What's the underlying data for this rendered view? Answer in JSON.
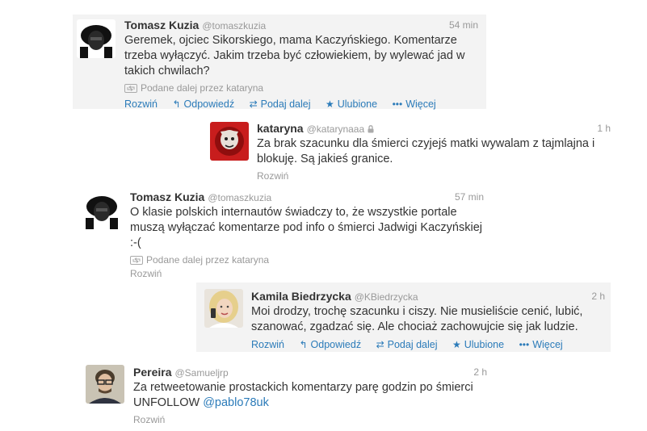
{
  "tweets": [
    {
      "name": "Tomasz Kuzia",
      "handle": "@tomaszkuzia",
      "time": "54 min",
      "text": "Geremek, ojciec Sikorskiego, mama Kaczyńskiego. Komentarze trzeba wyłączyć. Jakim trzeba być człowiekiem, by wylewać jad w takich chwilach?",
      "retweeted_by": "Podane dalej przez kataryna",
      "actions": {
        "expand": "Rozwiń",
        "reply": "Odpowiedź",
        "retweet": "Podaj dalej",
        "favorite": "Ulubione",
        "more": "Więcej"
      }
    },
    {
      "name": "kataryna",
      "handle": "@katarynaaa",
      "time": "1 h",
      "text": "Za brak szacunku dla śmierci czyjejś matki wywalam z tajmlajna i blokuję. Są jakieś granice.",
      "expand": "Rozwiń"
    },
    {
      "name": "Tomasz Kuzia",
      "handle": "@tomaszkuzia",
      "time": "57 min",
      "text": "O klasie polskich internautów świadczy to, że wszystkie portale muszą wyłączać komentarze pod info o śmierci Jadwigi Kaczyńskiej :-(",
      "retweeted_by": "Podane dalej przez kataryna",
      "expand": "Rozwiń"
    },
    {
      "name": "Kamila Biedrzycka",
      "handle": "@KBiedrzycka",
      "time": "2 h",
      "text": "Moi drodzy, trochę szacunku i ciszy. Nie musieliście cenić, lubić, szanować, zgadzać się. Ale chociaż zachowujcie się jak ludzie.",
      "actions": {
        "expand": "Rozwiń",
        "reply": "Odpowiedź",
        "retweet": "Podaj dalej",
        "favorite": "Ulubione",
        "more": "Więcej"
      }
    },
    {
      "name": "Pereira",
      "handle": "@Samueljrp",
      "time": "2 h",
      "text": "Za retweetowanie prostackich komentarzy parę godzin po śmierci UNFOLLOW ",
      "mention": "@pablo78uk",
      "expand": "Rozwiń"
    }
  ],
  "icons": {
    "reply": "reply-arrow-icon",
    "retweet": "retweet-icon",
    "favorite": "star-icon",
    "more": "ellipsis-icon",
    "lock": "lock-icon",
    "retweeted": "retweeted-icon"
  },
  "colors": {
    "link": "#2b7bb9",
    "muted": "#999999",
    "text": "#333333",
    "highlight_bg": "#f3f3f3"
  }
}
